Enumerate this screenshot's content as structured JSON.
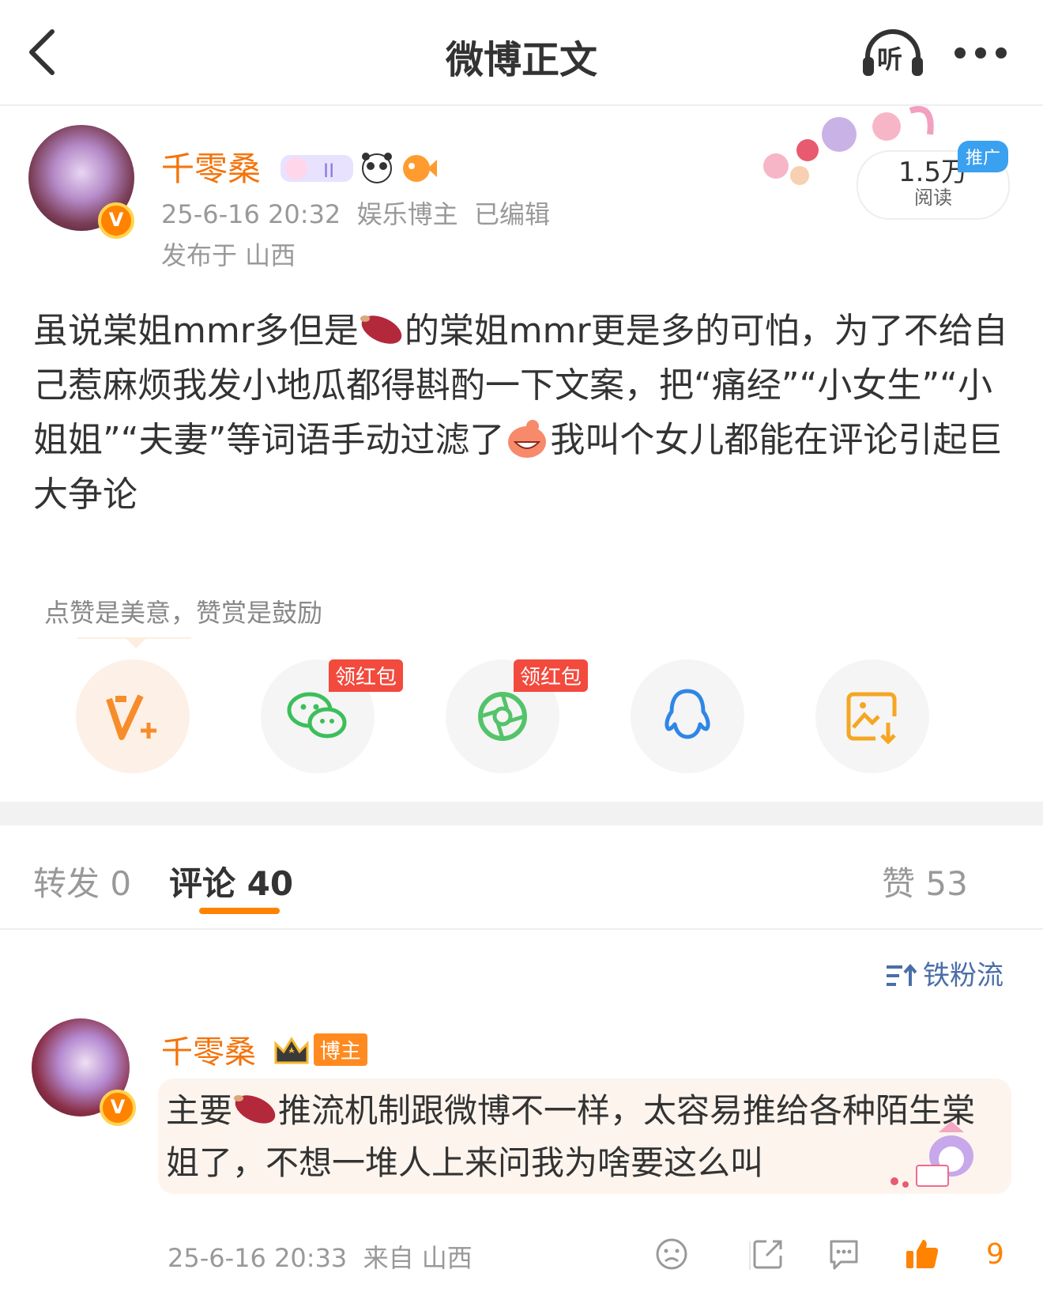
{
  "header": {
    "title": "微博正文",
    "listen_label": "听"
  },
  "post": {
    "author": "千零桑",
    "time": "25-6-16 20:32",
    "category": "娱乐博主",
    "edited": "已编辑",
    "location": "发布于 山西",
    "reads": {
      "count": "1.5万",
      "label": "阅读",
      "promo": "推广"
    },
    "text": {
      "p1": "虽说棠姐mmr多但是",
      "p2": "的棠姐mmr更是多的可怕，为了不给自己惹麻烦我发小地瓜都得斟酌一下文案，把“痛经”“小女生”“小姐姐”“夫妻”等词语手动过滤了",
      "p3": "我叫个女儿都能在评论引起巨大争论"
    }
  },
  "reward_hint": "点赞是美意，赞赏是鼓励",
  "share": {
    "red_packet": "领红包",
    "items": [
      "reward-icon",
      "wechat-icon",
      "moments-icon",
      "qq-icon",
      "save-image-icon"
    ]
  },
  "tabs": {
    "repost": "转发 0",
    "comment": "评论 40",
    "like": "赞 53"
  },
  "sort_label": "铁粉流",
  "comment": {
    "author": "千零桑",
    "badge": "博主",
    "text_a": "主要",
    "text_b": "推流机制跟微博不一样，太容易推给各种陌生棠姐了，不想一堆人上来问我为啥要这么叫",
    "time": "25-6-16 20:33",
    "source": "来自 山西",
    "likes": "9"
  },
  "colors": {
    "accent": "#ff8200",
    "username": "#f4730a",
    "link": "#4a6ea8"
  }
}
